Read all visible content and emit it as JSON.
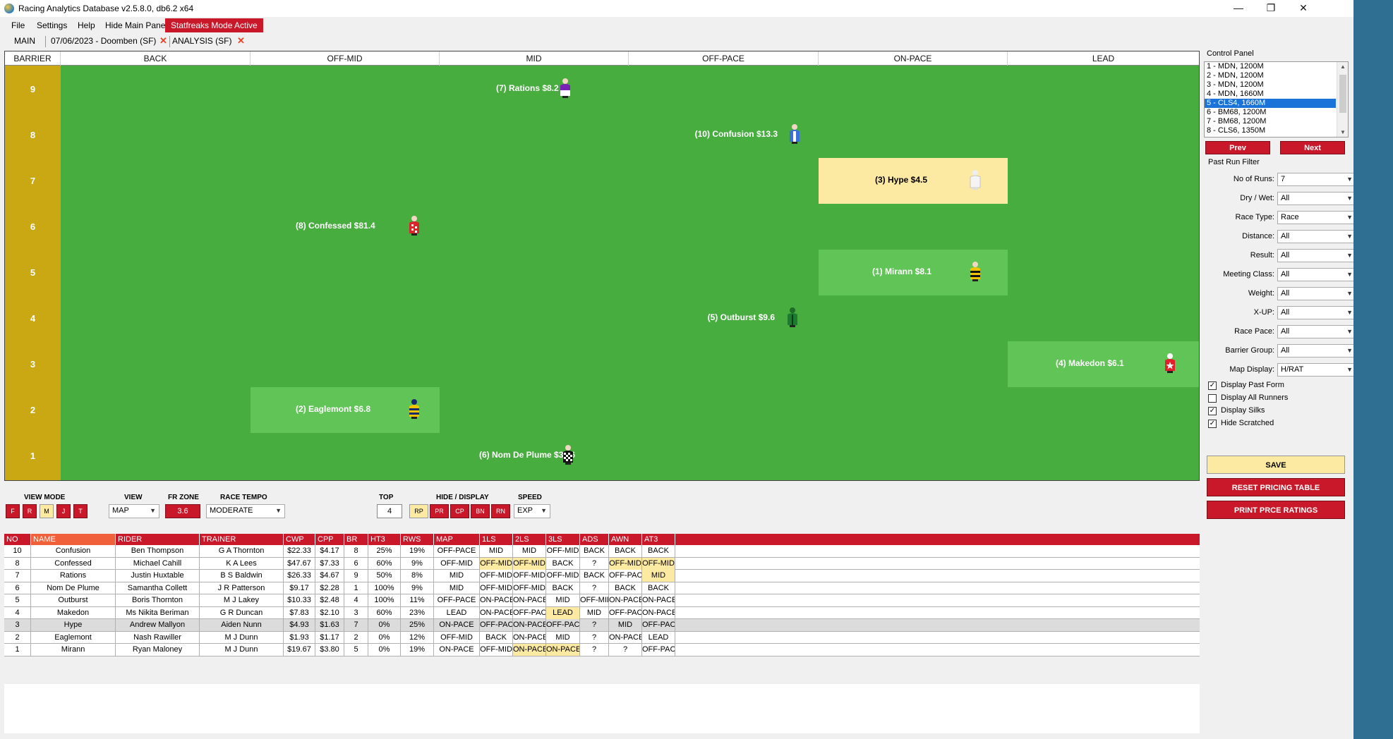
{
  "window": {
    "title": "Racing Analytics Database v2.5.8.0, db6.2 x64",
    "minimize": "—",
    "maximize": "❐",
    "close": "✕"
  },
  "menu": {
    "file": "File",
    "settings": "Settings",
    "help": "Help",
    "hide_main_panel": "Hide Main Panel",
    "statfreaks": "Statfreaks Mode Active"
  },
  "tabs": {
    "main": "MAIN",
    "race": "07/06/2023 - Doomben (SF)",
    "analysis": "ANALYSIS (SF)"
  },
  "map": {
    "columns": [
      "BARRIER",
      "BACK",
      "OFF-MID",
      "MID",
      "OFF-PACE",
      "ON-PACE",
      "LEAD"
    ],
    "barriers": [
      "9",
      "8",
      "7",
      "6",
      "5",
      "4",
      "3",
      "2",
      "1"
    ],
    "runners": [
      {
        "label": "(7) Rations $8.2",
        "barrier": 9,
        "position": "MID"
      },
      {
        "label": "(10) Confusion $13.3",
        "barrier": 8,
        "position": "OFF-PACE"
      },
      {
        "label": "(3) Hype $4.5",
        "barrier": 7,
        "position": "ON-PACE"
      },
      {
        "label": "(8) Confessed $81.4",
        "barrier": 6,
        "position": "OFF-MID"
      },
      {
        "label": "(1) Mirann $8.1",
        "barrier": 5,
        "position": "ON-PACE"
      },
      {
        "label": "(5) Outburst $9.6",
        "barrier": 4,
        "position": "OFF-PACE"
      },
      {
        "label": "(4) Makedon $6.1",
        "barrier": 3,
        "position": "LEAD"
      },
      {
        "label": "(2) Eaglemont $6.8",
        "barrier": 2,
        "position": "OFF-MID"
      },
      {
        "label": "(6) Nom De Plume $32.6",
        "barrier": 1,
        "position": "MID"
      }
    ]
  },
  "control_panel": {
    "title": "Control Panel",
    "races": [
      "1 - MDN, 1200M",
      "2 - MDN, 1200M",
      "3 - MDN, 1200M",
      "4 - MDN, 1660M",
      "5 - CLS4, 1660M",
      "6 - BM68, 1200M",
      "7 - BM68, 1200M",
      "8 - CLS6, 1350M"
    ],
    "selected_race": "5 - CLS4, 1660M",
    "prev": "Prev",
    "next": "Next",
    "filter_title": "Past Run Filter",
    "filters": [
      {
        "label": "No of Runs:",
        "value": "7"
      },
      {
        "label": "Dry / Wet:",
        "value": "All"
      },
      {
        "label": "Race Type:",
        "value": "Race"
      },
      {
        "label": "Distance:",
        "value": "All"
      },
      {
        "label": "Result:",
        "value": "All"
      },
      {
        "label": "Meeting Class:",
        "value": "All"
      },
      {
        "label": "Weight:",
        "value": "All"
      },
      {
        "label": "X-UP:",
        "value": "All"
      },
      {
        "label": "Race Pace:",
        "value": "All"
      },
      {
        "label": "Barrier Group:",
        "value": "All"
      },
      {
        "label": "Map Display:",
        "value": "H/RAT"
      }
    ],
    "checkboxes": [
      {
        "label": "Display Past Form",
        "checked": true
      },
      {
        "label": "Display All Runners",
        "checked": false
      },
      {
        "label": "Display Silks",
        "checked": true
      },
      {
        "label": "Hide Scratched",
        "checked": true
      }
    ],
    "save": "SAVE",
    "reset": "RESET PRICING TABLE",
    "print": "PRINT PRCE RATINGS"
  },
  "toolbar": {
    "view_mode_label": "VIEW MODE",
    "view_mode_buttons": [
      "F",
      "R",
      "M",
      "J",
      "T"
    ],
    "view_label": "VIEW",
    "view_value": "MAP",
    "fr_zone_label": "FR ZONE",
    "fr_zone_value": "3.6",
    "race_tempo_label": "RACE TEMPO",
    "race_tempo_value": "MODERATE",
    "top_label": "TOP",
    "top_value": "4",
    "hide_display_label": "HIDE / DISPLAY",
    "hide_display_buttons": [
      "RP",
      "PR",
      "CP",
      "BN",
      "RN"
    ],
    "speed_label": "SPEED",
    "speed_value": "EXP"
  },
  "table": {
    "headers": [
      "NO",
      "NAME",
      "RIDER",
      "TRAINER",
      "CWP",
      "CPP",
      "BR",
      "HT3",
      "RWS",
      "MAP",
      "1LS",
      "2LS",
      "3LS",
      "ADS",
      "AWN",
      "AT3"
    ],
    "rows": [
      [
        "10",
        "Confusion",
        "Ben Thompson",
        "G A Thornton",
        "$22.33",
        "$4.17",
        "8",
        "25%",
        "19%",
        "OFF-PACE",
        "MID",
        "MID",
        "OFF-MID",
        "BACK",
        "BACK",
        "BACK"
      ],
      [
        "8",
        "Confessed",
        "Michael Cahill",
        "K A Lees",
        "$47.67",
        "$7.33",
        "6",
        "60%",
        "9%",
        "OFF-MID",
        "OFF-MID",
        "OFF-MID",
        "BACK",
        "?",
        "OFF-MID",
        "OFF-MID"
      ],
      [
        "7",
        "Rations",
        "Justin Huxtable",
        "B S Baldwin",
        "$26.33",
        "$4.67",
        "9",
        "50%",
        "8%",
        "MID",
        "OFF-MID",
        "OFF-MID",
        "OFF-MID",
        "BACK",
        "OFF-PACE",
        "MID"
      ],
      [
        "6",
        "Nom De Plume",
        "Samantha Collett",
        "J R Patterson",
        "$9.17",
        "$2.28",
        "1",
        "100%",
        "9%",
        "MID",
        "OFF-MID",
        "OFF-MID",
        "BACK",
        "?",
        "BACK",
        "BACK"
      ],
      [
        "5",
        "Outburst",
        "Boris Thornton",
        "M J Lakey",
        "$10.33",
        "$2.48",
        "4",
        "100%",
        "11%",
        "OFF-PACE",
        "ON-PACE",
        "ON-PACE",
        "MID",
        "OFF-MID",
        "ON-PACE",
        "ON-PACE"
      ],
      [
        "4",
        "Makedon",
        "Ms Nikita Beriman",
        "G R Duncan",
        "$7.83",
        "$2.10",
        "3",
        "60%",
        "23%",
        "LEAD",
        "ON-PACE",
        "OFF-PACE",
        "LEAD",
        "MID",
        "OFF-PACE",
        "ON-PACE"
      ],
      [
        "3",
        "Hype",
        "Andrew Mallyon",
        "Aiden Nunn",
        "$4.93",
        "$1.63",
        "7",
        "0%",
        "25%",
        "ON-PACE",
        "OFF-PACE",
        "ON-PACE",
        "OFF-PACE",
        "?",
        "MID",
        "OFF-PACE"
      ],
      [
        "2",
        "Eaglemont",
        "Nash Rawiller",
        "M J Dunn",
        "$1.93",
        "$1.17",
        "2",
        "0%",
        "12%",
        "OFF-MID",
        "BACK",
        "ON-PACE",
        "MID",
        "?",
        "ON-PACE",
        "LEAD"
      ],
      [
        "1",
        "Mirann",
        "Ryan Maloney",
        "M J Dunn",
        "$19.67",
        "$3.80",
        "5",
        "0%",
        "19%",
        "ON-PACE",
        "OFF-MID",
        "ON-PACE",
        "ON-PACE",
        "?",
        "?",
        "OFF-PACE"
      ]
    ],
    "highlighted_cells": [
      [
        1,
        10
      ],
      [
        1,
        11
      ],
      [
        1,
        14
      ],
      [
        1,
        15
      ],
      [
        2,
        15
      ],
      [
        5,
        12
      ],
      [
        8,
        11
      ],
      [
        8,
        12
      ]
    ],
    "selected_row": 6
  },
  "colors": {
    "accent_red": "#c8182a",
    "track_green": "#48ad3f",
    "highlight_green": "#61c457",
    "highlight_yellow": "#fce9a2",
    "barrier_gold": "#c9a813"
  }
}
